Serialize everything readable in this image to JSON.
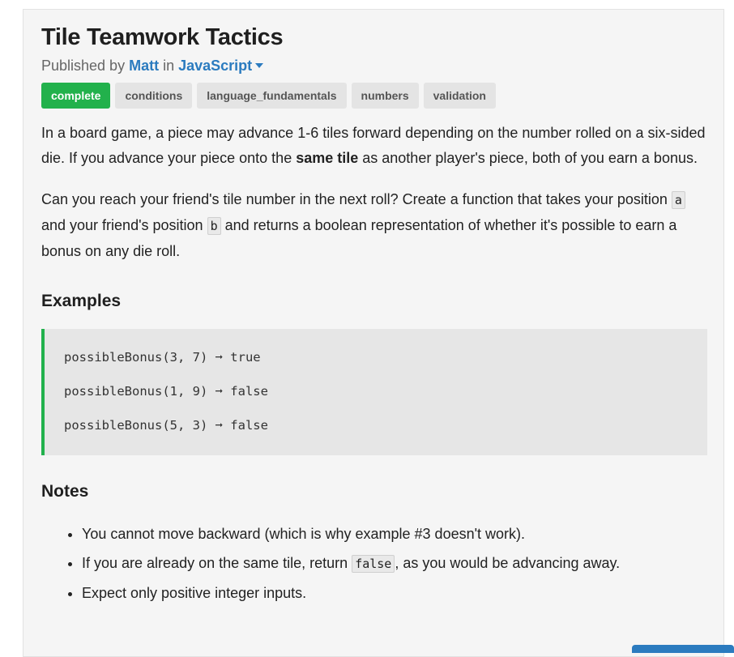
{
  "challenge": {
    "title": "Tile Teamwork Tactics",
    "published_prefix": "Published by ",
    "author": "Matt",
    "in_word": " in ",
    "language": "JavaScript"
  },
  "tags": [
    "complete",
    "conditions",
    "language_fundamentals",
    "numbers",
    "validation"
  ],
  "description": {
    "p1_part1": "In a board game, a piece may advance 1-6 tiles forward depending on the number rolled on a six-sided die. If you advance your piece onto the ",
    "p1_bold": "same tile",
    "p1_part2": " as another player's piece, both of you earn a bonus.",
    "p2_part1": "Can you reach your friend's tile number in the next roll? Create a function that takes your position ",
    "p2_code_a": "a",
    "p2_part2": " and your friend's position ",
    "p2_code_b": "b",
    "p2_part3": " and returns a boolean representation of whether it's possible to earn a bonus on any die roll."
  },
  "examples": {
    "heading": "Examples",
    "lines": [
      "possibleBonus(3, 7) ➞ true",
      "possibleBonus(1, 9) ➞ false",
      "possibleBonus(5, 3) ➞ false"
    ]
  },
  "notes": {
    "heading": "Notes",
    "item1": "You cannot move backward (which is why example #3 doesn't work).",
    "item2_part1": "If you are already on the same tile, return ",
    "item2_code": "false",
    "item2_part2": ", as you would be advancing away.",
    "item3": "Expect only positive integer inputs."
  },
  "colors": {
    "accent_green": "#22b14c",
    "link_blue": "#2b7bbf"
  }
}
